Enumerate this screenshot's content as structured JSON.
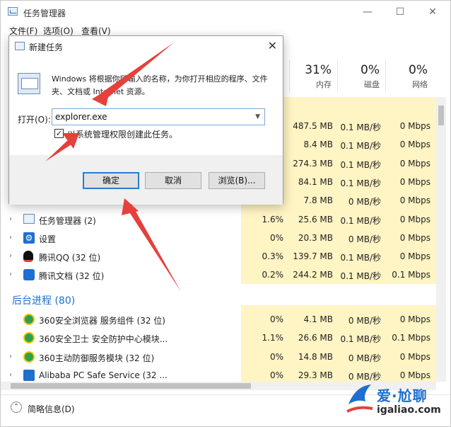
{
  "window": {
    "title": "任务管理器",
    "controls": {
      "minimize": "—",
      "maximize": "☐",
      "close": "✕"
    }
  },
  "menubar": [
    "文件(F)",
    "选项(O)",
    "查看(V)"
  ],
  "columns": [
    {
      "pct": "31%",
      "label": "内存"
    },
    {
      "pct": "0%",
      "label": "磁盘"
    },
    {
      "pct": "0%",
      "label": "网络"
    }
  ],
  "rows": [
    {
      "name": "",
      "cpu": "",
      "mem": "487.5 MB",
      "disk": "0.1 MB/秒",
      "net": "0 Mbps",
      "icon": "none"
    },
    {
      "name": "",
      "cpu": "",
      "mem": "8.4 MB",
      "disk": "0.1 MB/秒",
      "net": "0 Mbps",
      "icon": "none"
    },
    {
      "name": "",
      "cpu": "",
      "mem": "274.3 MB",
      "disk": "0.1 MB/秒",
      "net": "0 Mbps",
      "icon": "none"
    },
    {
      "name": "",
      "cpu": "",
      "mem": "84.1 MB",
      "disk": "0.1 MB/秒",
      "net": "0 Mbps",
      "icon": "none"
    },
    {
      "name": "",
      "cpu": "",
      "mem": "7.8 MB",
      "disk": "0 MB/秒",
      "net": "0 Mbps",
      "icon": "none"
    },
    {
      "name": "任务管理器 (2)",
      "cpu": "1.6%",
      "mem": "25.6 MB",
      "disk": "0.1 MB/秒",
      "net": "0 Mbps",
      "icon": "taskmgr-icon"
    },
    {
      "name": "设置",
      "cpu": "0%",
      "mem": "20.3 MB",
      "disk": "0 MB/秒",
      "net": "0 Mbps",
      "icon": "settings-gear-icon"
    },
    {
      "name": "腾讯QQ (32 位)",
      "cpu": "0.3%",
      "mem": "139.7 MB",
      "disk": "0.1 MB/秒",
      "net": "0 Mbps",
      "icon": "qq-penguin-icon"
    },
    {
      "name": "腾讯文档 (32 位)",
      "cpu": "0.2%",
      "mem": "244.2 MB",
      "disk": "0.1 MB/秒",
      "net": "0.1 Mbps",
      "icon": "tencent-docs-icon"
    }
  ],
  "section": "后台进程 (80)",
  "bg_rows": [
    {
      "name": "360安全浏览器 服务组件 (32 位)",
      "cpu": "0%",
      "mem": "4.1 MB",
      "disk": "0 MB/秒",
      "net": "0 Mbps",
      "icon": "360-browser-icon"
    },
    {
      "name": "360安全卫士 安全防护中心模块...",
      "cpu": "1.1%",
      "mem": "26.6 MB",
      "disk": "0.1 MB/秒",
      "net": "0.1 Mbps",
      "icon": "360-guard-icon"
    },
    {
      "name": "360主动防御服务模块 (32 位)",
      "cpu": "0%",
      "mem": "14.8 MB",
      "disk": "0 MB/秒",
      "net": "0 Mbps",
      "icon": "360-defense-icon"
    },
    {
      "name": "Alibaba PC Safe Service (32 ...",
      "cpu": "0%",
      "mem": "29.3 MB",
      "disk": "0 MB/秒",
      "net": "0 Mbps",
      "icon": "alibaba-icon"
    }
  ],
  "footer": {
    "brief": "简略信息(D)"
  },
  "watermark": {
    "text": "爱·尬聊",
    "url": "igaliao.com"
  },
  "dialog": {
    "title": "新建任务",
    "close": "✕",
    "description": "Windows 将根据你所输入的名称，为你打开相应的程序、文件夹、文档或 Internet 资源。",
    "open_label": "打开(O):",
    "open_value": "explorer.exe",
    "checkbox_checked": true,
    "checkbox_mark": "✓",
    "checkbox_label": "以系统管理权限创建此任务。",
    "ok": "确定",
    "cancel": "取消",
    "browse": "浏览(B)..."
  },
  "colors": {
    "accent": "#1e6fd0",
    "tint": "#fff4c4",
    "arrow": "#e5403b"
  }
}
